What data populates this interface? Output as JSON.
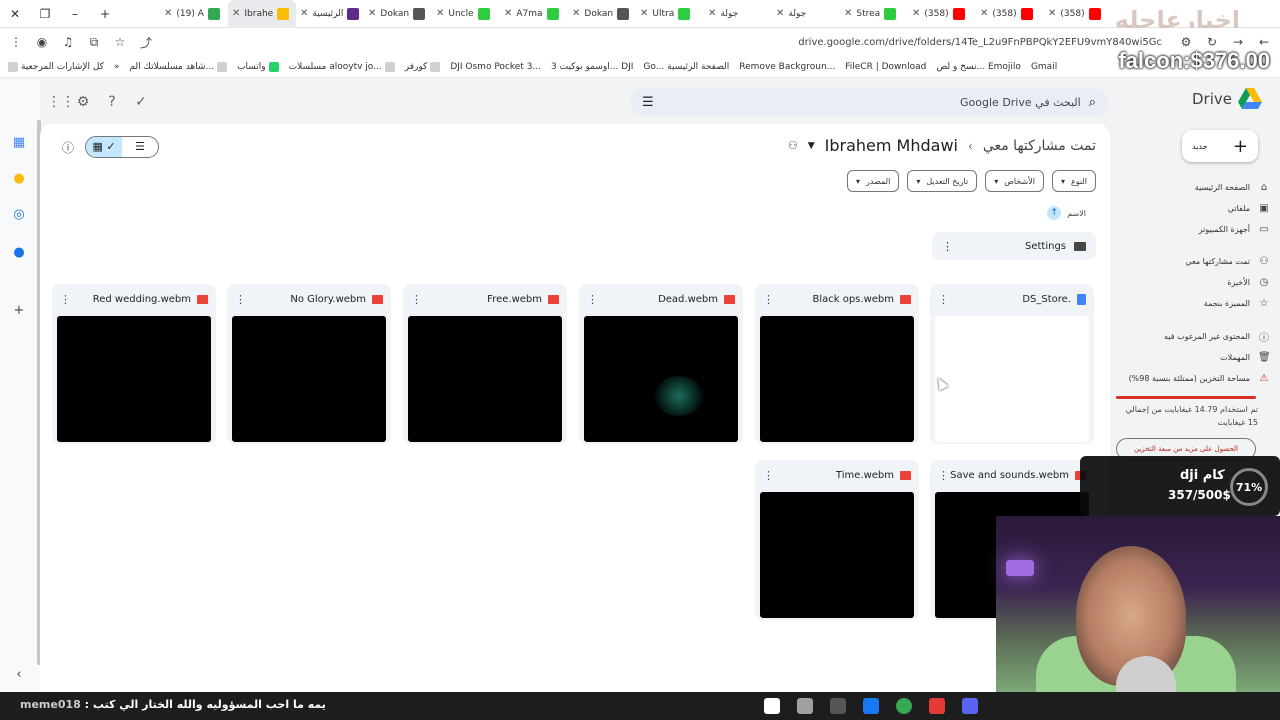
{
  "browser": {
    "tabs": [
      {
        "label": "(19) A",
        "active": false
      },
      {
        "label": "Ibrahe",
        "active": true
      },
      {
        "label": "الرئيسية",
        "active": false
      },
      {
        "label": "Dokan",
        "active": false
      },
      {
        "label": "Uncle",
        "active": false
      },
      {
        "label": "A7ma",
        "active": false
      },
      {
        "label": "Dokan",
        "active": false
      },
      {
        "label": "Ultra",
        "active": false
      },
      {
        "label": "جولة",
        "active": false
      },
      {
        "label": "جولة",
        "active": false
      },
      {
        "label": "Strea",
        "active": false
      },
      {
        "label": "(358)",
        "active": false
      },
      {
        "label": "(358)",
        "active": false
      },
      {
        "label": "(358)",
        "active": false
      }
    ],
    "url": "drive.google.com/drive/folders/14Te_L2u9FnPBPQkY2EFU9vmY840wi5Gc",
    "bookmarks": [
      "كل الإشارات المرجعية",
      "شاهد مسلسلاتك الم...",
      "واتساب",
      "مسلسلات alooytv jo...",
      "كورفر",
      "DJI Osmo Pocket 3...",
      "اوسمو بوكيت 3... DJI",
      "Go... الصفحة الرئيسية",
      "Remove Backgroun...",
      "FileCR | Download",
      "نسخ و لص... Emojilo",
      "Gmail"
    ]
  },
  "overlay": {
    "price": "falcon:$376.00",
    "watermark": "اخبارعاجله"
  },
  "drive": {
    "brand": "Drive",
    "search_placeholder": "البحث في Google Drive",
    "breadcrumb": {
      "root": "تمت مشاركتها معي",
      "current": "Ibrahem Mhdawi"
    },
    "filters": [
      "النوع",
      "الأشخاص",
      "تاريخ التعديل",
      "المصدر"
    ],
    "sort_label": "الاسم",
    "folders": [
      {
        "name": "Settings"
      }
    ],
    "files": [
      {
        "name": "DS_Store.",
        "type": "doc",
        "thumb": "white"
      },
      {
        "name": "Black ops.webm",
        "type": "video",
        "thumb": "black"
      },
      {
        "name": "Dead.webm",
        "type": "video",
        "thumb": "glow"
      },
      {
        "name": "Free.webm",
        "type": "video",
        "thumb": "black"
      },
      {
        "name": "No Glory.webm",
        "type": "video",
        "thumb": "black"
      },
      {
        "name": "Red wedding.webm",
        "type": "video",
        "thumb": "black"
      },
      {
        "name": "Save and sounds.webm",
        "type": "video",
        "thumb": "black"
      },
      {
        "name": "Time.webm",
        "type": "video",
        "thumb": "black"
      }
    ],
    "sidebar": {
      "new_label": "جديد",
      "nav": [
        {
          "label": "الصفحة الرئيسية",
          "icon": "home-icon"
        },
        {
          "label": "ملفاتي",
          "icon": "my-drive-icon"
        },
        {
          "label": "أجهزة الكمبيوتر",
          "icon": "computers-icon"
        },
        {
          "label": "تمت مشاركتها معي",
          "icon": "shared-icon"
        },
        {
          "label": "الأخيرة",
          "icon": "recent-icon"
        },
        {
          "label": "المميزة بنجمة",
          "icon": "star-icon"
        },
        {
          "label": "المحتوى غير المرغوب فيه",
          "icon": "spam-icon"
        },
        {
          "label": "المهملات",
          "icon": "trash-icon"
        },
        {
          "label": "مساحة التخزين (ممتلئة بنسبة 98%)",
          "icon": "warning-icon"
        }
      ],
      "storage_used_text": "تم استخدام 14.79 غيغابايت من إجمالي 15 غيغابايت",
      "storage_fraction": 0.98,
      "get_more_label": "الحصول على مزيد من سعة التخزين"
    }
  },
  "stream": {
    "goal_percent": "71%",
    "goal_title": "كام dji",
    "goal_amount": "357/500$",
    "chat_user": "meme018",
    "chat_message": ": يمه ما احب المسؤوليه والله الختار الي كتب"
  },
  "colors": {
    "accent": "#c2e7ff",
    "danger": "#d93025",
    "surface": "#f0f4f9"
  }
}
